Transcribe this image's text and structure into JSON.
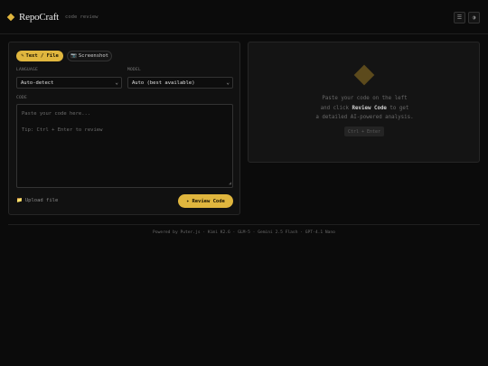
{
  "header": {
    "brand_name": "RepoCraft",
    "brand_tag": "code review",
    "menu_icon": "☰",
    "theme_icon": "◑"
  },
  "input_panel": {
    "tabs": [
      {
        "icon": "✎",
        "label": "Text / File",
        "active": true
      },
      {
        "icon": "📷",
        "label": "Screenshot",
        "active": false
      }
    ],
    "language_label": "LANGUAGE",
    "language_value": "Auto-detect",
    "model_label": "MODEL",
    "model_value": "Auto (best available)",
    "code_label": "CODE",
    "code_placeholder_line1": "Paste your code here...",
    "code_placeholder_line2": "Tip: Ctrl + Enter to review",
    "upload_icon": "📁",
    "upload_label": "Upload file",
    "review_icon": "✦",
    "review_label": "Review Code"
  },
  "result_panel": {
    "line1": "Paste your code on the left",
    "line2_pre": "and click",
    "line2_bold": "Review Code",
    "line2_post": "to get",
    "line3": "a detailed AI-powered analysis.",
    "shortcut": "Ctrl + Enter"
  },
  "footer": {
    "text": "Powered by Puter.js · Kimi K2.6 · GLM-5 · Gemini 2.5 Flash · GPT-4.1 Nano"
  },
  "colors": {
    "accent": "#e0b63e",
    "background": "#0b0b0b",
    "panel": "#111111"
  }
}
